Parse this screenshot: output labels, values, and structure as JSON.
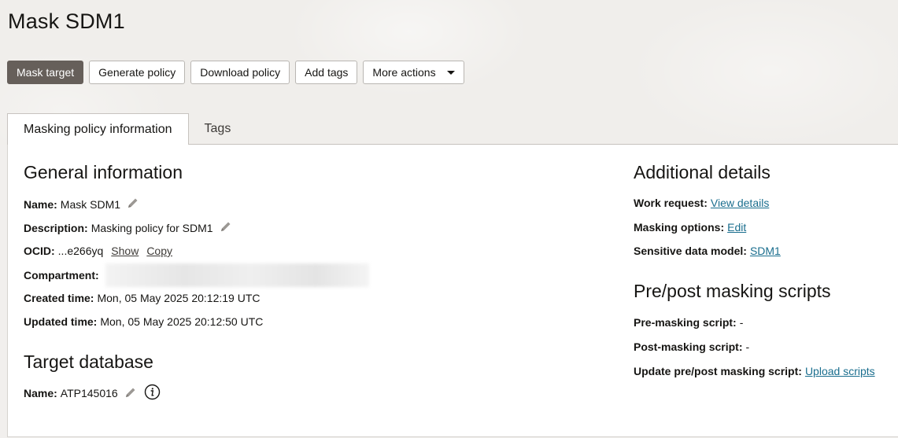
{
  "page": {
    "title": "Mask SDM1"
  },
  "actions": {
    "mask_target": "Mask target",
    "generate_policy": "Generate policy",
    "download_policy": "Download policy",
    "add_tags": "Add tags",
    "more_actions": "More actions"
  },
  "tabs": [
    {
      "label": "Masking policy information",
      "active": true
    },
    {
      "label": "Tags",
      "active": false
    }
  ],
  "general": {
    "heading": "General information",
    "name_label": "Name:",
    "name_value": "Mask SDM1",
    "description_label": "Description:",
    "description_value": "Masking policy for SDM1",
    "ocid_label": "OCID:",
    "ocid_value": "...e266yq",
    "show_link": "Show",
    "copy_link": "Copy",
    "compartment_label": "Compartment:",
    "created_label": "Created time:",
    "created_value": "Mon, 05 May 2025 20:12:19 UTC",
    "updated_label": "Updated time:",
    "updated_value": "Mon, 05 May 2025 20:12:50 UTC"
  },
  "target": {
    "heading": "Target database",
    "name_label": "Name:",
    "name_value": "ATP145016"
  },
  "additional": {
    "heading": "Additional details",
    "work_request_label": "Work request:",
    "work_request_link": "View details",
    "masking_options_label": "Masking options:",
    "masking_options_link": "Edit",
    "sdm_label": "Sensitive data model:",
    "sdm_link": "SDM1"
  },
  "scripts": {
    "heading": "Pre/post masking scripts",
    "pre_label": "Pre-masking script:",
    "pre_value": "-",
    "post_label": "Post-masking script:",
    "post_value": "-",
    "update_label": "Update pre/post masking script:",
    "update_link": "Upload scripts"
  },
  "colors": {
    "primary_button": "#665f5a",
    "link": "#1a6e8e"
  },
  "icons": {
    "edit": "pencil-icon",
    "info": "info-icon",
    "dropdown": "caret-down-icon"
  }
}
